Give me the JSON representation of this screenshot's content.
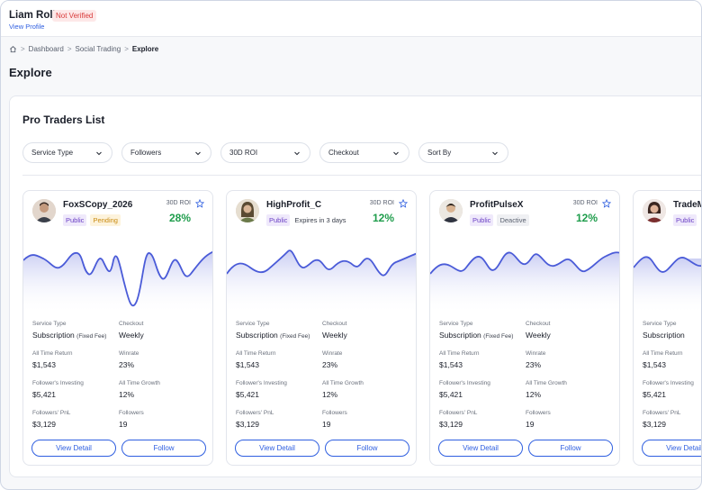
{
  "header": {
    "user_name": "Liam Rolin",
    "verification_badge": "Not Verified",
    "view_profile": "View Profile"
  },
  "breadcrumb": {
    "items": [
      "Dashboard",
      "Social Trading"
    ],
    "current": "Explore"
  },
  "page_title": "Explore",
  "panel": {
    "title": "Pro Traders List",
    "filters": [
      "Service Type",
      "Followers",
      "30D ROI",
      "Checkout",
      "Sort By"
    ]
  },
  "labels": {
    "roi": "30D ROI",
    "service_type": "Service Type",
    "checkout": "Checkout",
    "all_time_return": "All Time Return",
    "winrate": "Winrate",
    "followers_investing": "Follower's Investing",
    "all_time_growth": "All Time Growth",
    "followers_pnl": "Followers' PnL",
    "followers": "Followers",
    "view_detail": "View Detail",
    "follow": "Follow",
    "fixed_fee": "(Fixed Fee)"
  },
  "colors": {
    "accent": "#2f5fe0",
    "positive": "#1f9d4c",
    "spark_line": "#4a5bd8"
  },
  "traders": [
    {
      "name": "FoxSCopy_2026",
      "roi": "28%",
      "tag1": "Public",
      "tag2": "Pending",
      "service_type": "Subscription",
      "checkout": "Weekly",
      "all_time_return": "$1,543",
      "winrate": "23%",
      "followers_investing": "$5,421",
      "all_time_growth": "12%",
      "followers_pnl": "$3,129",
      "followers": "19"
    },
    {
      "name": "HighProfit_C",
      "roi": "12%",
      "tag1": "Public",
      "tag2": "Expires in 3 days",
      "service_type": "Subscription",
      "checkout": "Weekly",
      "all_time_return": "$1,543",
      "winrate": "23%",
      "followers_investing": "$5,421",
      "all_time_growth": "12%",
      "followers_pnl": "$3,129",
      "followers": "19"
    },
    {
      "name": "ProfitPulseX",
      "roi": "12%",
      "tag1": "Public",
      "tag2": "Deactive",
      "service_type": "Subscription",
      "checkout": "Weekly",
      "all_time_return": "$1,543",
      "winrate": "23%",
      "followers_investing": "$5,421",
      "all_time_growth": "12%",
      "followers_pnl": "$3,129",
      "followers": "19"
    },
    {
      "name": "TradeM",
      "roi": "",
      "tag1": "Public",
      "tag2": "",
      "service_type": "Subscription",
      "checkout": "",
      "all_time_return": "$1,543",
      "winrate": "",
      "followers_investing": "$5,421",
      "all_time_growth": "",
      "followers_pnl": "$3,129",
      "followers": ""
    }
  ]
}
